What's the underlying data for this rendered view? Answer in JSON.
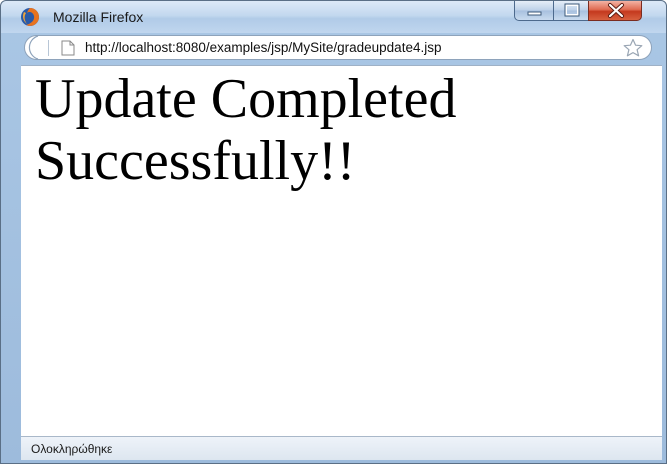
{
  "window": {
    "title": "Mozilla Firefox",
    "app_icon": "firefox-icon"
  },
  "navbar": {
    "url": "http://localhost:8080/examples/jsp/MySite/gradeupdate4.jsp",
    "page_icon": "page-icon",
    "bookmark_icon": "star-icon"
  },
  "content": {
    "heading": "Update Completed Successfully!!"
  },
  "statusbar": {
    "text": "Ολοκληρώθηκε"
  },
  "colors": {
    "close_button": "#c4391e",
    "frame": "#a9c6e4"
  }
}
